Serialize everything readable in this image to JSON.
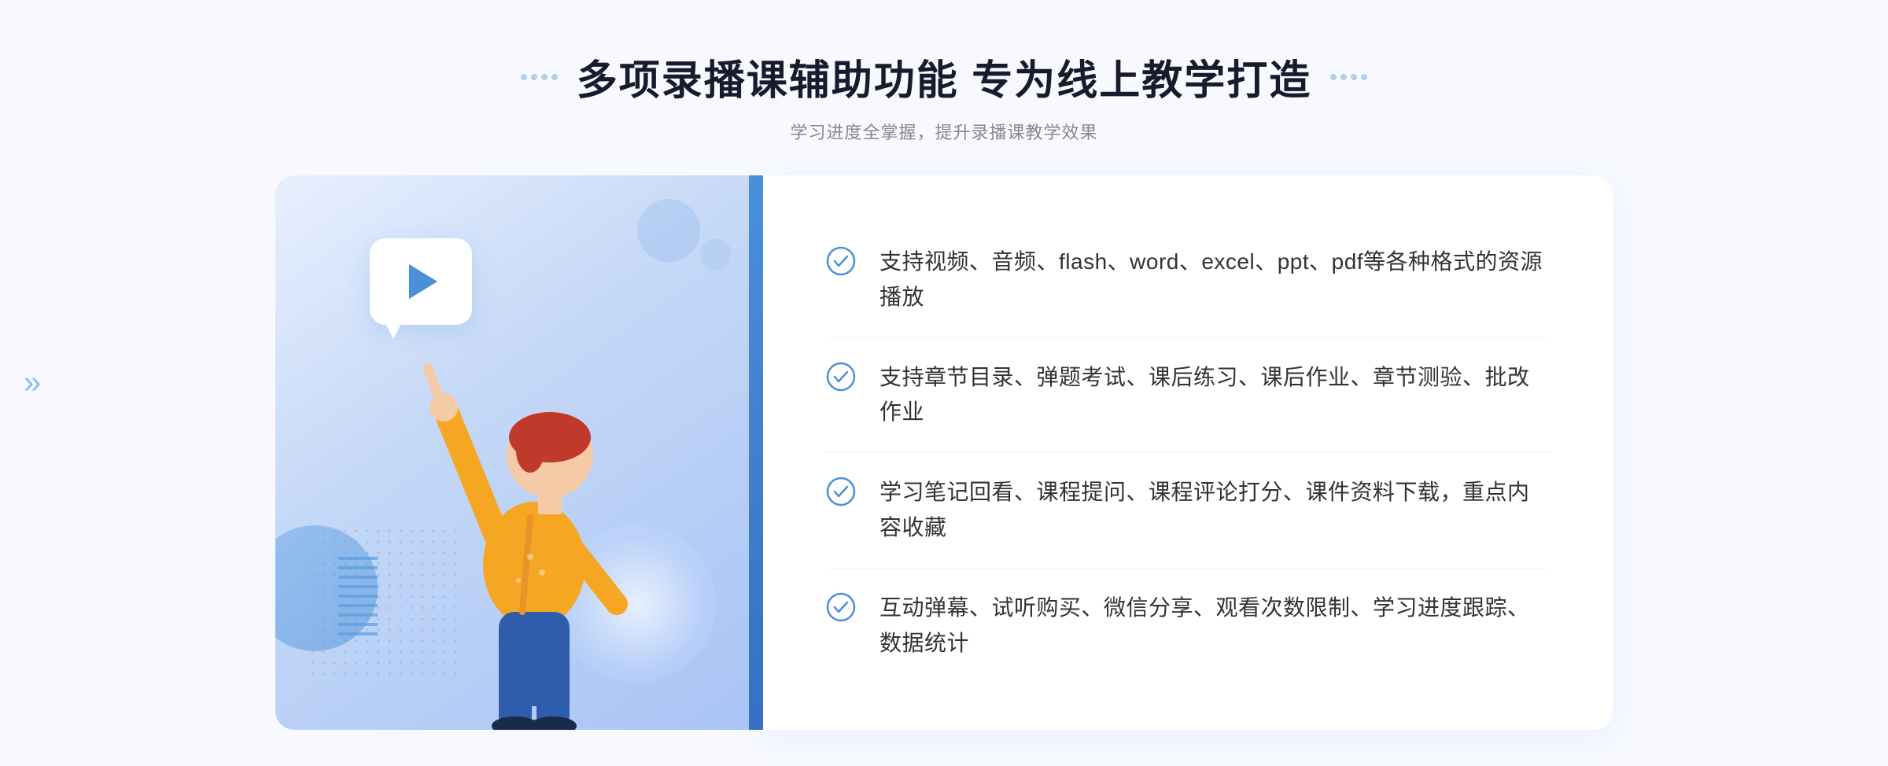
{
  "header": {
    "title": "多项录播课辅助功能 专为线上教学打造",
    "subtitle": "学习进度全掌握，提升录播课教学效果"
  },
  "features": [
    {
      "id": 1,
      "text": "支持视频、音频、flash、word、excel、ppt、pdf等各种格式的资源播放"
    },
    {
      "id": 2,
      "text": "支持章节目录、弹题考试、课后练习、课后作业、章节测验、批改作业"
    },
    {
      "id": 3,
      "text": "学习笔记回看、课程提问、课程评论打分、课件资料下载，重点内容收藏"
    },
    {
      "id": 4,
      "text": "互动弹幕、试听购买、微信分享、观看次数限制、学习进度跟踪、数据统计"
    }
  ],
  "icons": {
    "check": "check-circle-icon",
    "play": "play-icon",
    "arrow_left": "«"
  },
  "colors": {
    "primary": "#4a90d9",
    "primary_dark": "#3570c4",
    "text_main": "#333333",
    "text_sub": "#888888",
    "bg_light": "#f7f9ff",
    "white": "#ffffff"
  }
}
